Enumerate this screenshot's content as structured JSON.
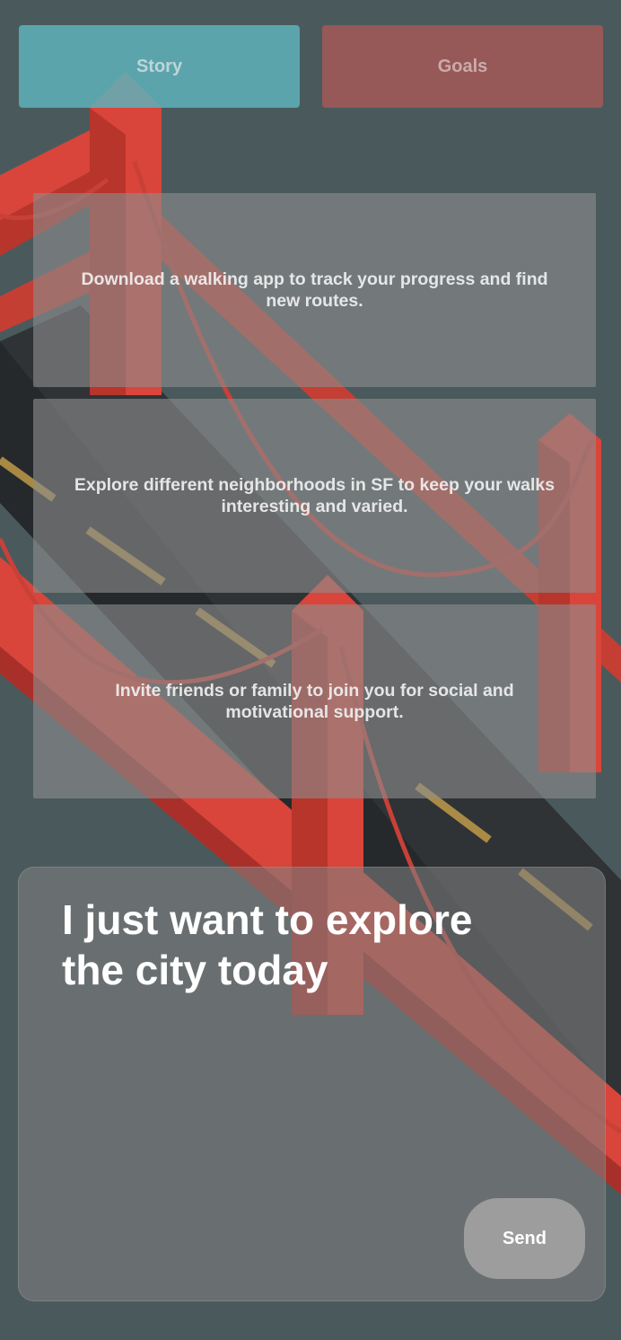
{
  "tabs": [
    {
      "label": "Story"
    },
    {
      "label": "Goals"
    }
  ],
  "suggestions": [
    {
      "text": "Download a walking app to track your progress and find new routes."
    },
    {
      "text": "Explore different neighborhoods in SF to keep your walks interesting and varied."
    },
    {
      "text": "Invite friends or family to join you for social and motivational support."
    }
  ],
  "composer": {
    "message": "I just want to explore the city today",
    "send_label": "Send"
  },
  "colors": {
    "story_tab": "#5eb2ba",
    "goals_tab": "#a85858",
    "bridge_red": "#d9453a",
    "road_dark": "#2f3336",
    "lane_yellow": "#c9a24a"
  }
}
